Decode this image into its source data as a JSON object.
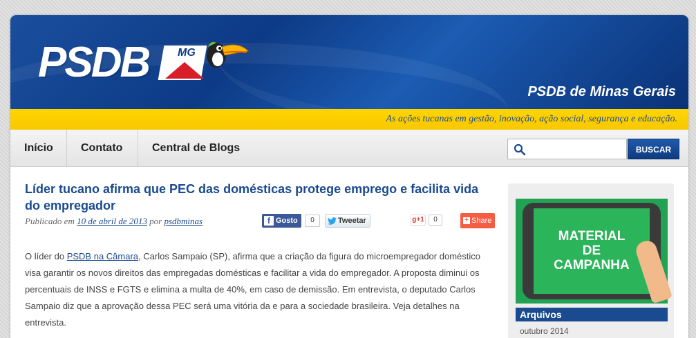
{
  "header": {
    "logo_text": "PSDB",
    "logo_badge": "MG",
    "site_title": "PSDB de Minas Gerais",
    "tagline": "As ações tucanas em gestão, inovação, ação social, segurança e educação."
  },
  "nav": {
    "items": [
      {
        "label": "Início"
      },
      {
        "label": "Contato"
      },
      {
        "label": "Central de Blogs"
      }
    ],
    "search": {
      "value": "",
      "button_label": "BUSCAR"
    }
  },
  "post": {
    "title": "Líder tucano afirma que PEC das domésticas protege emprego e facilita vida do empregador",
    "meta_published": "Publicado em",
    "meta_date": "10 de abril de 2013",
    "meta_by": "por",
    "meta_author": "psdbminas",
    "share": {
      "facebook_label": "Gosto",
      "facebook_count": "0",
      "twitter_label": "Tweetar",
      "gplus_label": "g+1",
      "gplus_count": "0",
      "share_label": "Share"
    },
    "body_before_link": "O líder do ",
    "body_link": "PSDB na Câmara",
    "body_after_link": ", Carlos Sampaio (SP), afirma que a criação da figura do microempregador doméstico visa garantir os novos direitos das empregadas domésticas e facilitar a vida do empregador. A proposta diminui os percentuais de INSS e FGTS e elimina a multa de 40%, em caso de demissão. Em entrevista, o deputado Carlos Sampaio diz que a aprovação dessa PEC será uma vitória da e para a sociedade brasileira. Veja detalhes na entrevista."
  },
  "sidebar": {
    "banner_line1": "MATERIAL",
    "banner_line2": "DE",
    "banner_line3": "CAMPANHA",
    "archives_title": "Arquivos",
    "archive_item": "outubro 2014"
  },
  "colors": {
    "brand_blue": "#1a4a8f",
    "header_blue": "#0d3a85",
    "yellow": "#ffd500",
    "green": "#21a353"
  }
}
